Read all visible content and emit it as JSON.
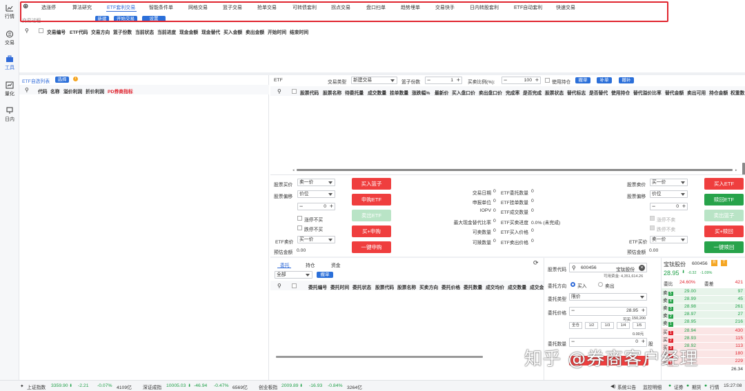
{
  "nav": [
    {
      "label": "行情",
      "icon": "chart-icon"
    },
    {
      "label": "交易",
      "icon": "exchange-icon"
    },
    {
      "label": "工具",
      "icon": "toolbox-icon"
    },
    {
      "label": "量化",
      "icon": "quant-icon"
    },
    {
      "label": "日内",
      "icon": "intraday-icon"
    }
  ],
  "tabs": [
    "选涨停",
    "算法研究",
    "ETF套利交易",
    "智能条件单",
    "网格交易",
    "篮子交易",
    "抢单交易",
    "可转债套利",
    "拐点交易",
    "盘口扫单",
    "趋势埋单",
    "交易快手",
    "日内转股套利",
    "ETF自动套利",
    "快速交易"
  ],
  "subbar": {
    "left_text": "交易过程",
    "buttons": [
      "新建",
      "开始交易",
      "设置"
    ]
  },
  "trade_columns": [
    "交易编号",
    "ETF代码",
    "交易方向",
    "篮子份数",
    "当前状态",
    "当前进度",
    "现金金额",
    "现金替代",
    "买入金额",
    "卖出金额",
    "开始时间",
    "结束时间"
  ],
  "etf_list": {
    "title": "ETF自选列表",
    "select_btn": "选择",
    "columns": [
      "代码",
      "名称",
      "溢价利润",
      "折价利润"
    ],
    "red_col": "PD券商指标"
  },
  "etf_form": {
    "etf_label": "ETF",
    "trade_type_label": "交易类型",
    "trade_type_value": "新建交易",
    "basket_label": "篮子份数",
    "basket_value": "1",
    "ratio_label": "买卖比例(%):",
    "ratio_value": "100",
    "use_position": "使用持仓",
    "btn_cancel": "撤单",
    "btn_fill": "补单",
    "btn_replenish": "撤补"
  },
  "stock_columns": [
    "股票代码",
    "股票名称",
    "待委托量",
    "成交数量",
    "挂单数量",
    "涨跌幅%",
    "最新价",
    "买入盘口价",
    "卖出盘口价",
    "完成率",
    "是否完成",
    "股票状态",
    "替代标志",
    "是否替代",
    "使用持仓",
    "替代溢价比率",
    "替代金额",
    "卖出可用",
    "持仓金额",
    "权重数"
  ],
  "left_ctrl": {
    "buy_price_label": "股票买价",
    "buy_price_value": "卖一价",
    "offset_label": "股票偏移",
    "offset_value": "价位",
    "stepper_value": "0",
    "limit_up": "涨停不买",
    "limit_down": "跌停不买",
    "etf_sell_label": "ETF卖价",
    "etf_sell_value": "买一价",
    "est_label": "预估金额",
    "est_value": "0.00"
  },
  "left_buttons": [
    "买入篮子",
    "申购ETF",
    "卖出ETF",
    "买+申购",
    "一键申购"
  ],
  "info": {
    "rows": [
      {
        "k1": "交易日期",
        "v1": "0",
        "k2": "ETF委托数量",
        "v2": "0"
      },
      {
        "k1": "申报单位",
        "v1": "0",
        "k2": "ETF挂单数量",
        "v2": "0"
      },
      {
        "k1": "IOPV",
        "v1": "0",
        "k2": "ETF成交数量",
        "v2": "0"
      },
      {
        "k1": "最大现金替代比率",
        "v1": "0",
        "k2": "ETF买卖进度",
        "v2": "0.0% (未完成)"
      },
      {
        "k1": "可卖数量",
        "v1": "0",
        "k2": "ETF买入价格",
        "v2": "0"
      },
      {
        "k1": "可赎数量",
        "v1": "0",
        "k2": "ETF卖出价格",
        "v2": "0"
      }
    ]
  },
  "right_ctrl": {
    "sell_price_label": "股票卖价",
    "sell_price_value": "买一价",
    "offset_label": "股票偏移",
    "offset_value": "价位",
    "stepper_value": "0",
    "limit_up": "涨停不卖",
    "limit_down": "跌停不卖",
    "etf_buy_label": "ETF买价",
    "etf_buy_value": "卖一价",
    "est_label": "预估金额",
    "est_value": "0.00"
  },
  "right_buttons": [
    "买入ETF",
    "赎回ETF",
    "卖出篮子",
    "买+赎回",
    "一键赎回"
  ],
  "order_tabs": [
    "委托",
    "持仓",
    "资金"
  ],
  "order_filter": {
    "value": "全部",
    "cancel": "撤单"
  },
  "order_columns": [
    "委托编号",
    "委托时间",
    "委托状态",
    "股票代码",
    "股票名称",
    "买卖方向",
    "委托价格",
    "委托数量",
    "成交均价",
    "成交数量",
    "成交金"
  ],
  "order_form": {
    "code_label": "股票代码",
    "code_value": "600456",
    "code_name": "宝钛股份",
    "available": "可用资金: 4,351,614.26",
    "dir_label": "委托方向",
    "dir_buy": "买入",
    "dir_sell": "卖出",
    "type_label": "委托类型",
    "type_value": "限价",
    "price_label": "委托价格",
    "price_value": "28.95",
    "can_buy_label": "可买:",
    "can_buy_value": "150,200",
    "fractions": [
      "全仓",
      "1/2",
      "1/3",
      "1/4",
      "1/5"
    ],
    "amount_value": "0.00元",
    "qty_label": "委托数量",
    "qty_value": "0",
    "qty_unit": "股"
  },
  "quote": {
    "name": "宝钛股份",
    "code": "600456",
    "badge_r": "R",
    "badge_t": "T",
    "price": "28.95",
    "change": "-0.32",
    "pct": "-1.09%",
    "wb_label": "委比",
    "wb_value": "24.60%",
    "wc_label": "委差",
    "wc_value": "421",
    "sells": [
      {
        "k": "卖",
        "n": "5",
        "p": "29.00",
        "v": "97"
      },
      {
        "k": "卖",
        "n": "4",
        "p": "28.99",
        "v": "45"
      },
      {
        "k": "卖",
        "n": "3",
        "p": "28.98",
        "v": "261"
      },
      {
        "k": "卖",
        "n": "2",
        "p": "28.97",
        "v": "27"
      },
      {
        "k": "卖",
        "n": "1",
        "p": "28.95",
        "v": "216"
      }
    ],
    "buys": [
      {
        "k": "买",
        "n": "1",
        "p": "28.94",
        "v": "430"
      },
      {
        "k": "买",
        "n": "2",
        "p": "28.93",
        "v": "115"
      },
      {
        "k": "买",
        "n": "3",
        "p": "28.92",
        "v": "113"
      },
      {
        "k": "买",
        "n": "4",
        "p": "",
        "v": "180"
      },
      {
        "k": "买",
        "n": "5",
        "p": "",
        "v": "229"
      }
    ],
    "last": "26.34"
  },
  "status": {
    "sh_label": "上证指数",
    "sh_value": "3359.90",
    "sh_chg": "-2.21",
    "sh_pct": "-0.07%",
    "sh_amt": "4109亿",
    "sz_label": "深证成指",
    "sz_value": "10005.03",
    "sz_chg": "-46.94",
    "sz_pct": "-0.47%",
    "sz_amt": "6569亿",
    "cy_label": "创业板指",
    "cy_value": "2009.89",
    "cy_chg": "-16.93",
    "cy_pct": "-0.84%",
    "cy_amt": "3264亿",
    "notice": "系统公告",
    "monitor": "监控明细",
    "ind1": "证券",
    "ind2": "期货",
    "ind3": "行情",
    "time": "15:27:08"
  },
  "watermark": "知乎 @券商客户经理",
  "colors": {
    "accent": "#2b6fd9",
    "red": "#ef3e3e",
    "green": "#27a34a",
    "highlight": "#e0242e"
  }
}
